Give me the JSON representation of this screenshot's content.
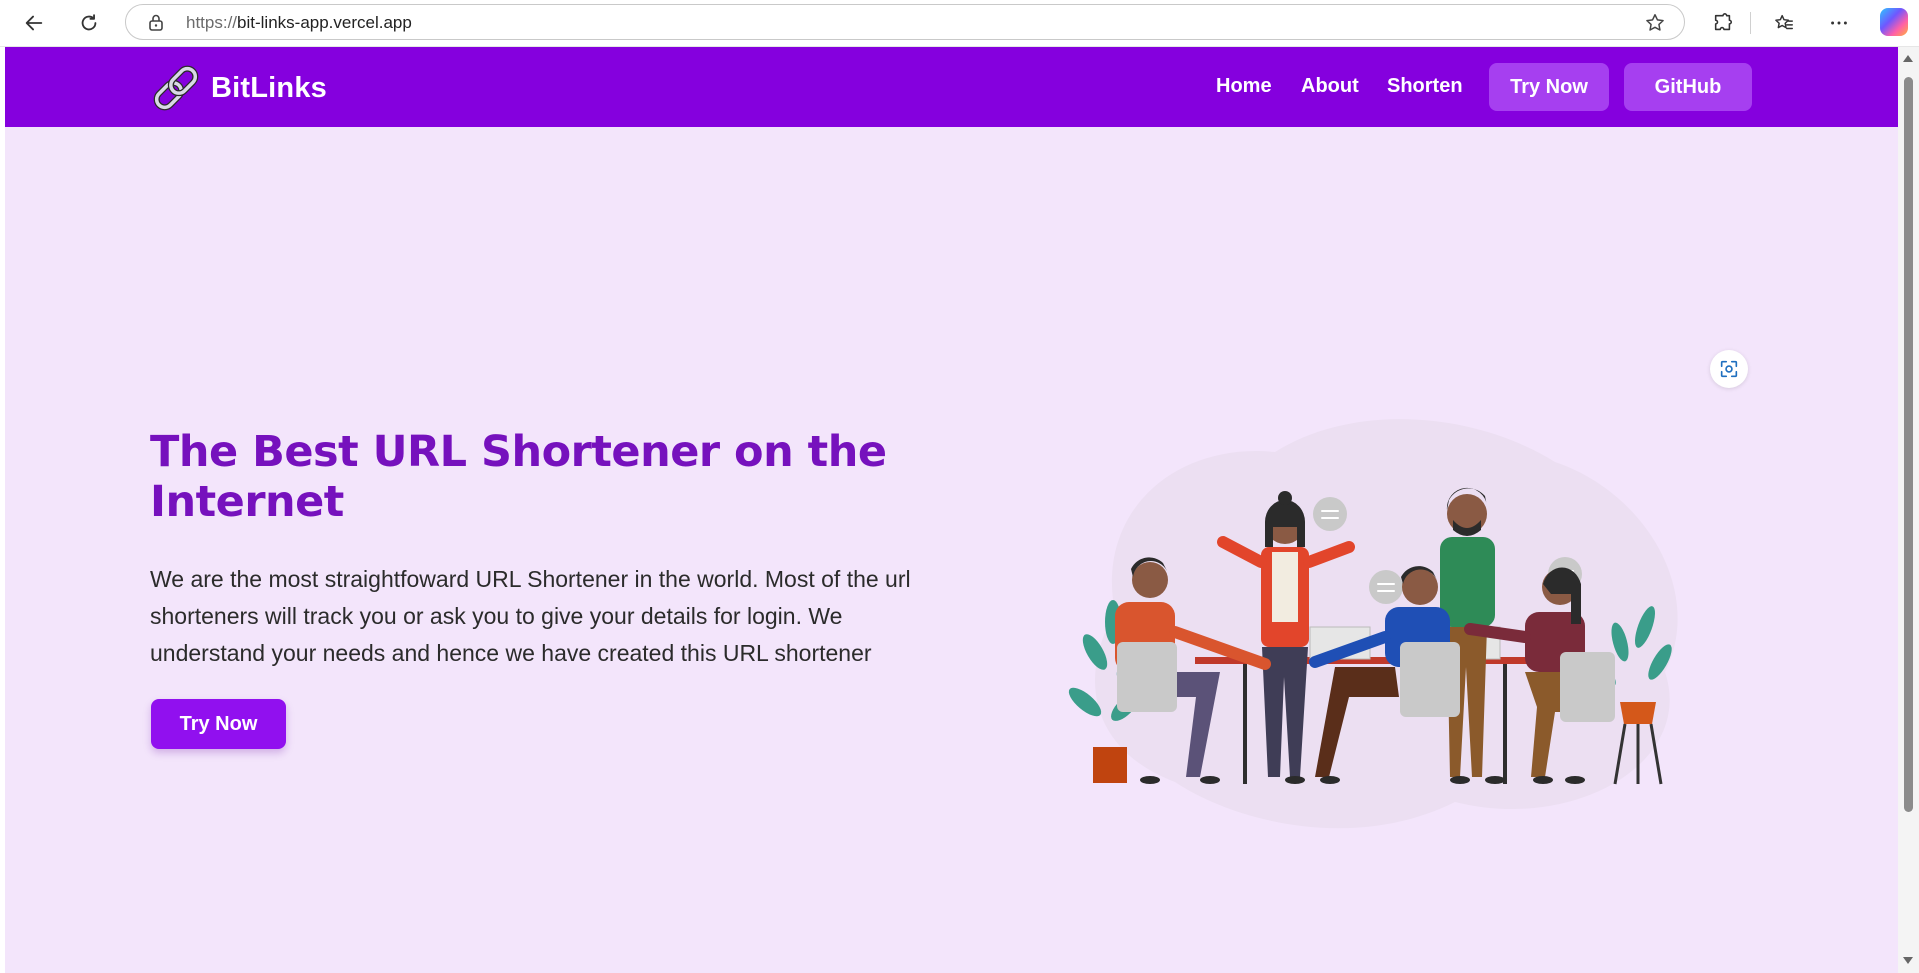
{
  "browser": {
    "url_scheme": "https://",
    "url_host": "bit-links-app.vercel.app",
    "icons": [
      "back-arrow-icon",
      "reload-icon",
      "lock-icon",
      "star-icon",
      "extensions-icon",
      "favorites-icon",
      "more-icon",
      "copilot-icon"
    ]
  },
  "navbar": {
    "brand": "BitLinks",
    "links": [
      "Home",
      "About",
      "Shorten"
    ],
    "try_now_label": "Try Now",
    "github_label": "GitHub",
    "colors": {
      "bar": "#8500de",
      "button": "#a63ff0"
    }
  },
  "hero": {
    "title": "The Best URL Shortener on the Internet",
    "description": "We are the most straightfoward URL Shortener in the world. Most of the url shorteners will track you or ask you to give your details for login. We understand your needs and hence we have created this URL shortener",
    "cta_label": "Try Now",
    "colors": {
      "title": "#7611bd",
      "cta": "#9110ef",
      "background": "#f3e5fb"
    }
  }
}
